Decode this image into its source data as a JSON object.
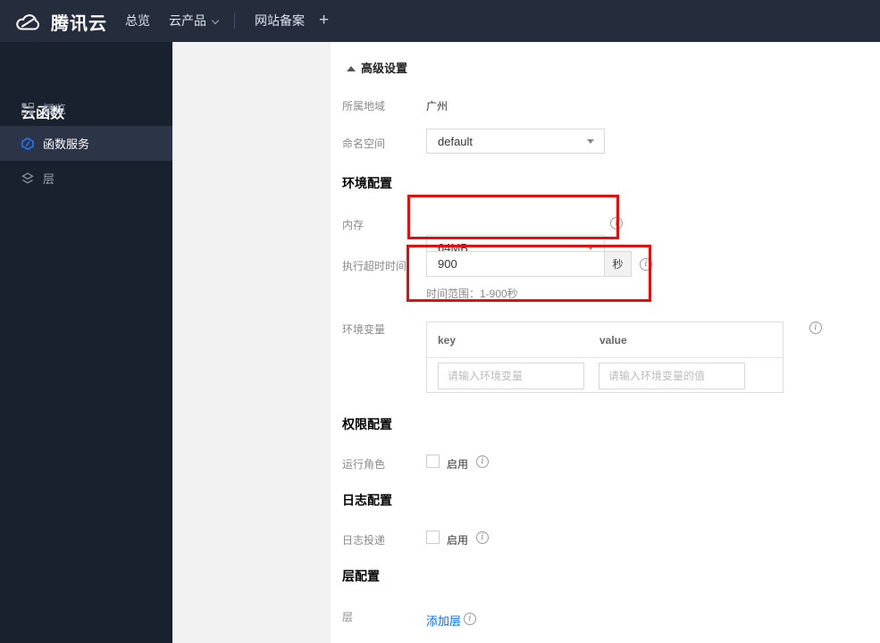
{
  "topbar": {
    "logo": "腾讯云",
    "overview": "总览",
    "products": "云产品",
    "icp": "网站备案",
    "plus": "+"
  },
  "sidebar": {
    "title": "云函数",
    "items": [
      {
        "label": "概览",
        "icon": "grid-icon",
        "selected": false
      },
      {
        "label": "函数服务",
        "icon": "function-icon",
        "selected": true
      },
      {
        "label": "层",
        "icon": "layers-icon",
        "selected": false
      }
    ]
  },
  "content": {
    "advanced_toggle": "高级设置",
    "region": {
      "label": "所属地域",
      "value": "广州"
    },
    "namespace": {
      "label": "命名空间",
      "value": "default"
    },
    "section_env": "环境配置",
    "memory": {
      "label": "内存",
      "value": "64MB"
    },
    "timeout": {
      "label": "执行超时时间",
      "value": "900",
      "unit": "秒",
      "hint": "时间范围：1-900秒"
    },
    "envvars": {
      "label": "环境变量",
      "col_key": "key",
      "col_value": "value",
      "key_placeholder": "请输入环境变量",
      "value_placeholder": "请输入环境变量的值"
    },
    "section_perm": "权限配置",
    "role": {
      "label": "运行角色",
      "enable": "启用"
    },
    "section_log": "日志配置",
    "logship": {
      "label": "日志投递",
      "enable": "启用"
    },
    "section_layer": "层配置",
    "layer": {
      "label": "层",
      "add_link": "添加层"
    }
  },
  "colors": {
    "topbar_bg": "#252d3d",
    "sidebar_bg": "#1a212e",
    "sidebar_selected_bg": "#2c3547",
    "accent_blue": "#006eff",
    "highlight_red": "#e60d0d",
    "panel_gray": "#f2f2f2"
  }
}
